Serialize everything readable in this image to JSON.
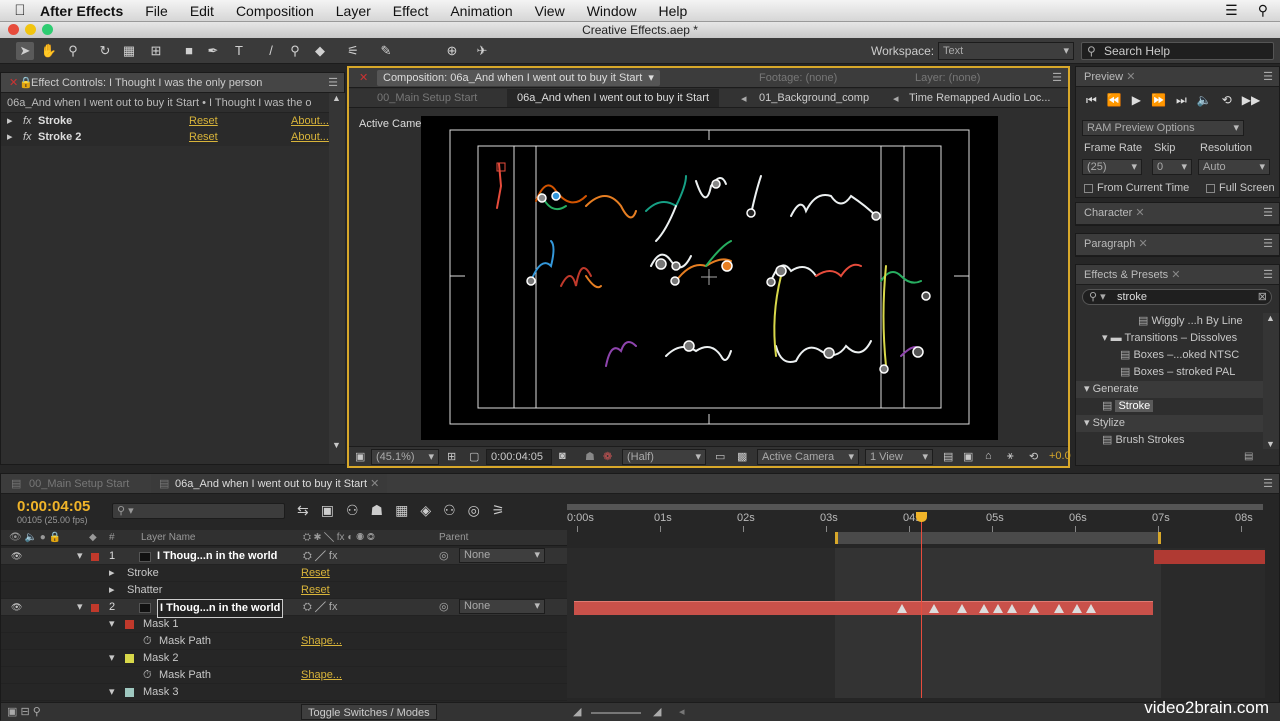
{
  "menubar": {
    "app": "After Effects",
    "items": [
      "File",
      "Edit",
      "Composition",
      "Layer",
      "Effect",
      "Animation",
      "View",
      "Window",
      "Help"
    ]
  },
  "window_title": "Creative Effects.aep *",
  "toolbar": {
    "workspace_label": "Workspace:",
    "workspace_value": "Text",
    "search_placeholder": "Search Help"
  },
  "effect_controls": {
    "tab": "Effect Controls: I Thought I was the only person",
    "subtitle": "06a_And when I went out to buy it Start • I Thought I was the o",
    "effects": [
      {
        "name": "Stroke",
        "reset": "Reset",
        "about": "About..."
      },
      {
        "name": "Stroke 2",
        "reset": "Reset",
        "about": "About..."
      }
    ]
  },
  "composition": {
    "tab_comp": "Composition: 06a_And when I went out to buy it Start",
    "tab_footage": "Footage: (none)",
    "tab_layer": "Layer: (none)",
    "flow": [
      "00_Main Setup Start",
      "06a_And when I went out to buy it Start",
      "01_Background_comp",
      "Time Remapped Audio Loc..."
    ],
    "camera_label": "Active Camera",
    "footer": {
      "zoom": "(45.1%)",
      "timecode": "0:00:04:05",
      "resolution": "(Half)",
      "camera": "Active Camera",
      "view": "1 View",
      "offset": "+0.0"
    }
  },
  "preview": {
    "title": "Preview",
    "ram_options": "RAM Preview Options",
    "frame_rate_label": "Frame Rate",
    "skip_label": "Skip",
    "resolution_label": "Resolution",
    "frame_rate": "(25)",
    "skip": "0",
    "resolution": "Auto",
    "from_current": "From Current Time",
    "full_screen": "Full Screen"
  },
  "character": {
    "title": "Character"
  },
  "paragraph": {
    "title": "Paragraph"
  },
  "effects_presets": {
    "title": "Effects & Presets",
    "search": "stroke",
    "items": [
      {
        "label": "Wiggly ...h By Line",
        "indent": 3,
        "kind": "preset"
      },
      {
        "label": "Transitions – Dissolves",
        "indent": 1,
        "kind": "folder"
      },
      {
        "label": "Boxes –...oked NTSC",
        "indent": 2,
        "kind": "preset"
      },
      {
        "label": "Boxes – stroked PAL",
        "indent": 2,
        "kind": "preset"
      },
      {
        "label": "Generate",
        "indent": 0,
        "kind": "category"
      },
      {
        "label": "Stroke",
        "indent": 1,
        "kind": "effect-selected"
      },
      {
        "label": "Stylize",
        "indent": 0,
        "kind": "category"
      },
      {
        "label": "Brush Strokes",
        "indent": 1,
        "kind": "effect"
      }
    ]
  },
  "timeline": {
    "tabs": [
      "00_Main Setup Start",
      "06a_And when I went out to buy it Start"
    ],
    "timecode": "0:00:04:05",
    "fps": "00105 (25.00 fps)",
    "col_layer_name": "Layer Name",
    "col_parent": "Parent",
    "ruler": [
      "0:00s",
      "01s",
      "02s",
      "03s",
      "04s",
      "05s",
      "06s",
      "07s",
      "08s"
    ],
    "layers": [
      {
        "num": "1",
        "name": "I Thoug...n in the world",
        "parent": "None",
        "kind": "layer"
      },
      {
        "num": "",
        "name": "Stroke",
        "reset": "Reset",
        "kind": "effect"
      },
      {
        "num": "",
        "name": "Shatter",
        "reset": "Reset",
        "kind": "effect"
      },
      {
        "num": "2",
        "name": "I Thoug...n in the world",
        "parent": "None",
        "kind": "layer"
      },
      {
        "num": "",
        "name": "Mask 1",
        "kind": "mask",
        "color": "#c0392b"
      },
      {
        "num": "",
        "name": "Mask Path",
        "value": "Shape...",
        "kind": "prop"
      },
      {
        "num": "",
        "name": "Mask 2",
        "kind": "mask",
        "color": "#d8d84a"
      },
      {
        "num": "",
        "name": "Mask Path",
        "value": "Shape...",
        "kind": "prop"
      },
      {
        "num": "",
        "name": "Mask 3",
        "kind": "mask",
        "color": "#9fc8c0"
      }
    ],
    "toggle_label": "Toggle Switches / Modes"
  },
  "watermark": "video2brain.com"
}
